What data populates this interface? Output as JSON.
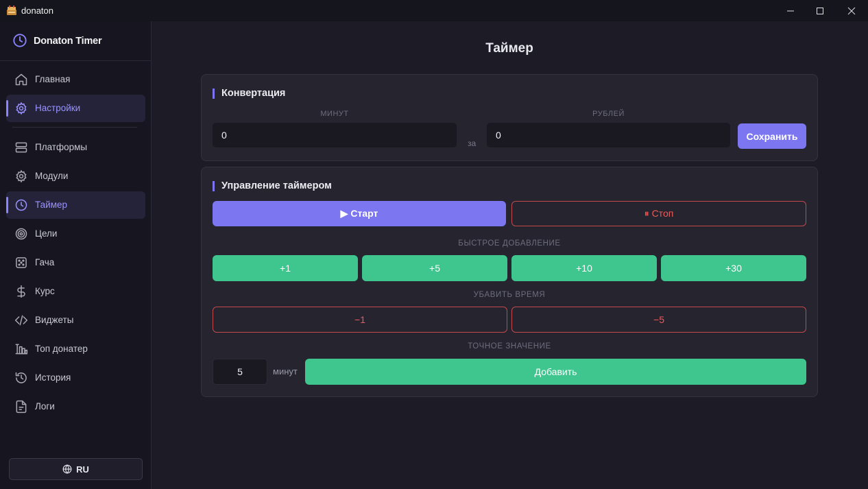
{
  "window": {
    "title": "donaton",
    "controls": [
      "minimize-icon",
      "maximize-icon",
      "close-icon"
    ]
  },
  "sidebar": {
    "brand": "Donaton Timer",
    "items": [
      {
        "label": "Главная",
        "icon": "home-icon"
      },
      {
        "label": "Настройки",
        "icon": "gear-icon"
      },
      {
        "label": "Платформы",
        "icon": "server-icon"
      },
      {
        "label": "Модули",
        "icon": "gear-icon"
      },
      {
        "label": "Таймер",
        "icon": "clock-icon"
      },
      {
        "label": "Цели",
        "icon": "target-icon"
      },
      {
        "label": "Гача",
        "icon": "dice-icon"
      },
      {
        "label": "Курс",
        "icon": "dollar-icon"
      },
      {
        "label": "Виджеты",
        "icon": "code-icon"
      },
      {
        "label": "Топ донатер",
        "icon": "podium-icon"
      },
      {
        "label": "История",
        "icon": "history-icon"
      },
      {
        "label": "Логи",
        "icon": "file-icon"
      }
    ],
    "highlighted": [
      "Настройки",
      "Таймер"
    ],
    "language_button": "RU"
  },
  "main": {
    "title": "Таймер",
    "conversion": {
      "title": "Конвертация",
      "minutes_label": "МИНУТ",
      "minutes_value": "0",
      "connector": "за",
      "rubles_label": "РУБЛЕЙ",
      "rubles_value": "0",
      "save_button": "Сохранить"
    },
    "timer_control": {
      "title": "Управление таймером",
      "start_button": "▶ Старт",
      "stop_button": "⏸ Стоп",
      "quick_add_label": "БЫСТРОЕ ДОБАВЛЕНИЕ",
      "quick_add": [
        "+1",
        "+5",
        "+10",
        "+30"
      ],
      "subtract_label": "УБАВИТЬ ВРЕМЯ",
      "subtract": [
        "−1",
        "−5"
      ],
      "exact_label": "ТОЧНОЕ ЗНАЧЕНИЕ",
      "exact_value": "5",
      "exact_unit": "минут",
      "add_button": "Добавить"
    }
  },
  "colors": {
    "accent": "#7c77f0",
    "green": "#3ec68e",
    "red": "#ef5a5a",
    "background": "#1c1b26",
    "sidebar": "#171620",
    "card": "#25242f"
  }
}
